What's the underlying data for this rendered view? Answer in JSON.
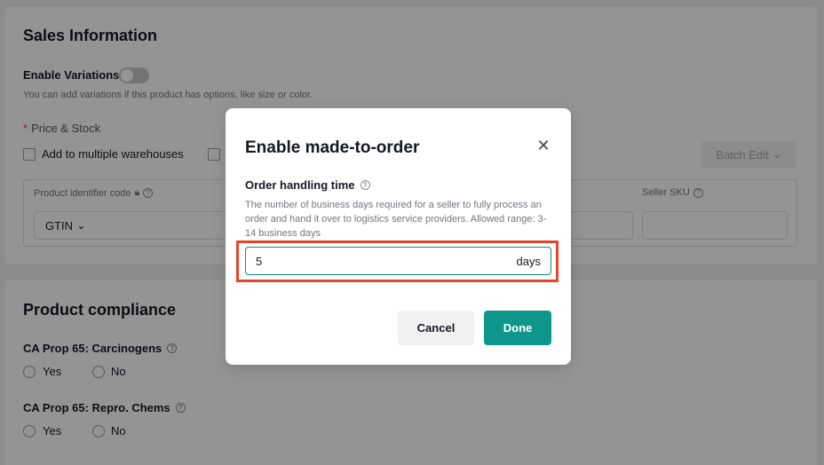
{
  "sales": {
    "title": "Sales Information",
    "enable_variations_label": "Enable Variations",
    "variations_hint": "You can add variations if this product has options, like size or color.",
    "price_stock_label": "Price & Stock",
    "multi_warehouse_label": "Add to multiple warehouses",
    "batch_edit_label": "Batch Edit",
    "table": {
      "col_identifier": "Product identifier code",
      "col_seller_sku": "Seller SKU",
      "gtin_value": "GTIN"
    }
  },
  "compliance": {
    "title": "Product compliance",
    "q1_label": "CA Prop 65: Carcinogens",
    "q2_label": "CA Prop 65: Repro. Chems",
    "yes_label": "Yes",
    "no_label": "No"
  },
  "modal": {
    "title": "Enable made-to-order",
    "field_label": "Order handling time",
    "field_desc": "The number of business days required for a seller to fully process an order and hand it over to logistics service providers. Allowed range: 3-14 business days",
    "input_value": "5",
    "input_suffix": "days",
    "cancel_label": "Cancel",
    "done_label": "Done"
  },
  "icons": {
    "close": "close-icon",
    "help": "help-icon",
    "lock": "lock-icon",
    "chevron": "chevron-down-icon"
  },
  "colors": {
    "primary": "#0e968c",
    "highlight": "#e8442a",
    "required": "#e0333c"
  }
}
